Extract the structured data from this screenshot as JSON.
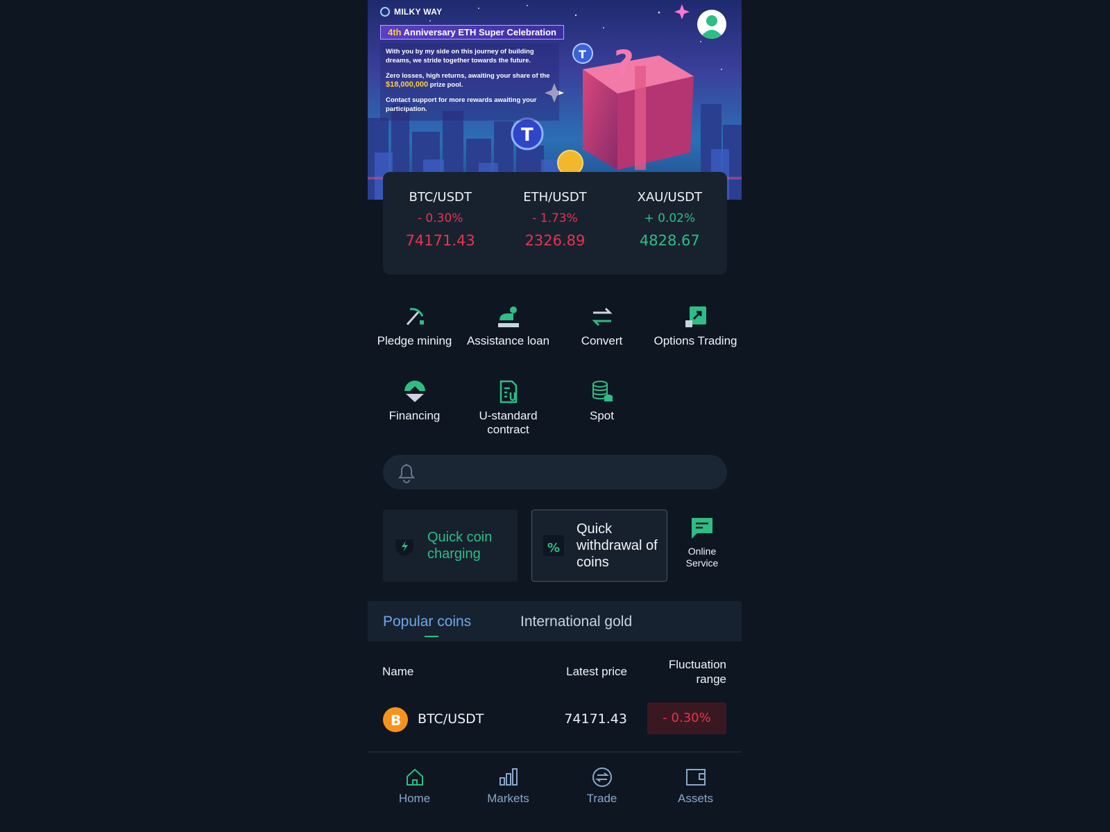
{
  "banner": {
    "brand": "MILKY WAY",
    "promo_title_highlight": "4th",
    "promo_title_rest": " Anniversary ETH Super Celebration",
    "line1": "With you by my side on this journey of building dreams, we stride together towards the future.",
    "line2_a": "Zero losses, high returns, awaiting your share of the",
    "line2_amount": "$18,000,000",
    "line2_b": " prize pool.",
    "line3": "Contact support for more rewards awaiting your participation."
  },
  "tickers": [
    {
      "pair": "BTC/USDT",
      "change": "- 0.30%",
      "price": "74171.43"
    },
    {
      "pair": "ETH/USDT",
      "change": "- 1.73%",
      "price": "2326.89"
    },
    {
      "pair": "XAU/USDT",
      "change": "+ 0.02%",
      "price": "4828.67"
    }
  ],
  "functions": [
    {
      "label": "Pledge mining",
      "icon": "pickaxe-icon"
    },
    {
      "label": "Assistance loan",
      "icon": "loan-icon"
    },
    {
      "label": "Convert",
      "icon": "convert-arrows-icon"
    },
    {
      "label": "Options Trading",
      "icon": "options-chart-icon"
    },
    {
      "label": "Financing",
      "icon": "financing-icon"
    },
    {
      "label": "U-standard contract",
      "icon": "contract-document-icon"
    },
    {
      "label": "Spot",
      "icon": "coin-stack-icon"
    }
  ],
  "quick": {
    "charge": "Quick coin charging",
    "withdraw": "Quick withdrawal of coins",
    "online": "Online Service"
  },
  "tabs": {
    "popular": "Popular coins",
    "gold": "International gold"
  },
  "table": {
    "col_name": "Name",
    "col_price": "Latest price",
    "col_range": "Fluctuation range",
    "rows": [
      {
        "symbol": "BTC/USDT",
        "price": "74171.43",
        "range": "- 0.30%"
      }
    ]
  },
  "nav": {
    "home": "Home",
    "markets": "Markets",
    "trade": "Trade",
    "assets": "Assets"
  },
  "colors": {
    "background": "#0e1622",
    "accent_green": "#2ebd85",
    "down_red": "#e8334f",
    "tab_active_blue": "#6fa8e8"
  }
}
